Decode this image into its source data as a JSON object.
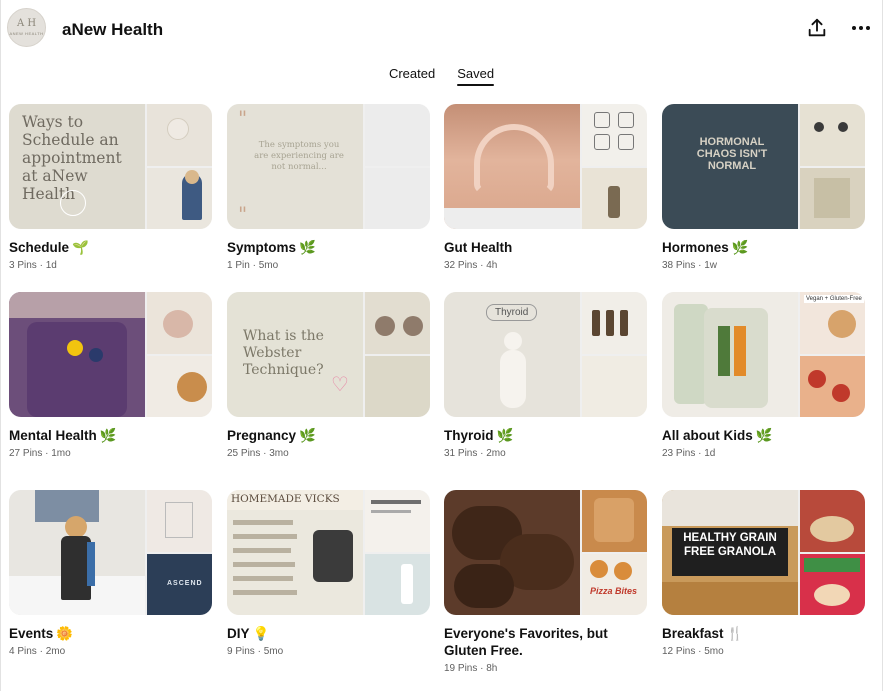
{
  "profile": {
    "name": "aNew Health",
    "avatar_mark": "A H",
    "avatar_text": "ANEW HEALTH"
  },
  "header": {
    "share_icon": "share-icon",
    "more_icon": "more-dots-icon"
  },
  "tabs": [
    {
      "label": "Created",
      "active": false
    },
    {
      "label": "Saved",
      "active": true
    }
  ],
  "boards": [
    {
      "title": "Schedule",
      "emoji": "🌱",
      "pins": "3 Pins",
      "age": "1d",
      "cover_text": "Ways to Schedule an appointment at aNew Health"
    },
    {
      "title": "Symptoms",
      "emoji": "🌿",
      "pins": "1 Pin",
      "age": "5mo",
      "cover_text": "The symptoms you are experiencing are not normal..."
    },
    {
      "title": "Gut Health",
      "emoji": "",
      "pins": "32 Pins",
      "age": "4h",
      "cover_text": ""
    },
    {
      "title": "Hormones",
      "emoji": "🌿",
      "pins": "38 Pins",
      "age": "1w",
      "cover_text": "HORMONAL CHAOS ISN'T NORMAL"
    },
    {
      "title": "Mental Health",
      "emoji": "🌿",
      "pins": "27 Pins",
      "age": "1mo",
      "cover_text": ""
    },
    {
      "title": "Pregnancy",
      "emoji": "🌿",
      "pins": "25 Pins",
      "age": "3mo",
      "cover_text": "What is the Webster Technique?"
    },
    {
      "title": "Thyroid",
      "emoji": "🌿",
      "pins": "31 Pins",
      "age": "2mo",
      "cover_text": "Thyroid"
    },
    {
      "title": "All about Kids",
      "emoji": "🌿",
      "pins": "23 Pins",
      "age": "1d",
      "cover_text": "Vegan + Gluten-Free"
    },
    {
      "title": "Events",
      "emoji": "🌼",
      "pins": "4 Pins",
      "age": "2mo",
      "cover_text": "ASCEND"
    },
    {
      "title": "DIY",
      "emoji": "💡",
      "pins": "9 Pins",
      "age": "5mo",
      "cover_text": "HOMEMADE VICKS"
    },
    {
      "title": "Everyone's Favorites, but Gluten Free.",
      "emoji": "",
      "pins": "19 Pins",
      "age": "8h",
      "cover_text": "Pizza Bites"
    },
    {
      "title": "Breakfast",
      "emoji": "🍴",
      "pins": "12 Pins",
      "age": "5mo",
      "cover_text": "HEALTHY GRAIN FREE GRANOLA"
    }
  ],
  "colors": {
    "text": "#111111",
    "meta": "#5f5f5f",
    "beige": "#e7e4dc",
    "sage": "#c9c9b7"
  }
}
